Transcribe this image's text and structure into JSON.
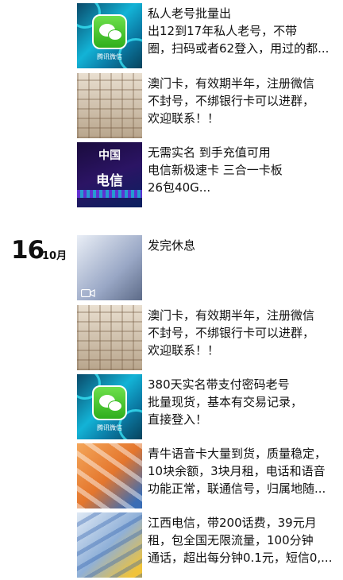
{
  "date": {
    "day": "16",
    "month": "10月"
  },
  "posts_before": [
    {
      "thumb": "wechat",
      "thumb_caption": "腾讯微信",
      "lines": [
        "私人老号批量出",
        "出12到17年私人老号，不带",
        "圈，扫码或者62登入，用过的都..."
      ]
    },
    {
      "thumb": "boxes",
      "lines": [
        "澳门卡，有效期半年，注册微信",
        "不封号，不绑银行卡可以进群，",
        "欢迎联系！！"
      ]
    },
    {
      "thumb": "telecom",
      "thumb_text": [
        "中国",
        "电信"
      ],
      "lines": [
        "无需实名 到手充值可用",
        "电信新极速卡 三合一卡板",
        "26包40G..."
      ]
    }
  ],
  "posts_after": [
    {
      "thumb": "video",
      "thumb_icon": "video-camera-icon",
      "lines": [
        "发完休息"
      ]
    },
    {
      "thumb": "boxes",
      "lines": [
        "澳门卡，有效期半年，注册微信",
        "不封号，不绑银行卡可以进群，",
        "欢迎联系！！"
      ]
    },
    {
      "thumb": "wechat",
      "thumb_caption": "腾讯微信",
      "lines": [
        "380天实名带支付密码老号",
        "批量现货，基本有交易记录，",
        "直接登入！"
      ]
    },
    {
      "thumb": "cards",
      "lines": [
        "青牛语音卡大量到货，质量稳定，",
        "10块余额，3块月租，电话和语音",
        "功能正常，联通信号，归属地随..."
      ]
    },
    {
      "thumb": "sims",
      "lines": [
        "江西电信，带200话费，39元月",
        "租，包全国无限流量，100分钟",
        "通话，超出每分钟0.1元，短信0,..."
      ]
    }
  ]
}
